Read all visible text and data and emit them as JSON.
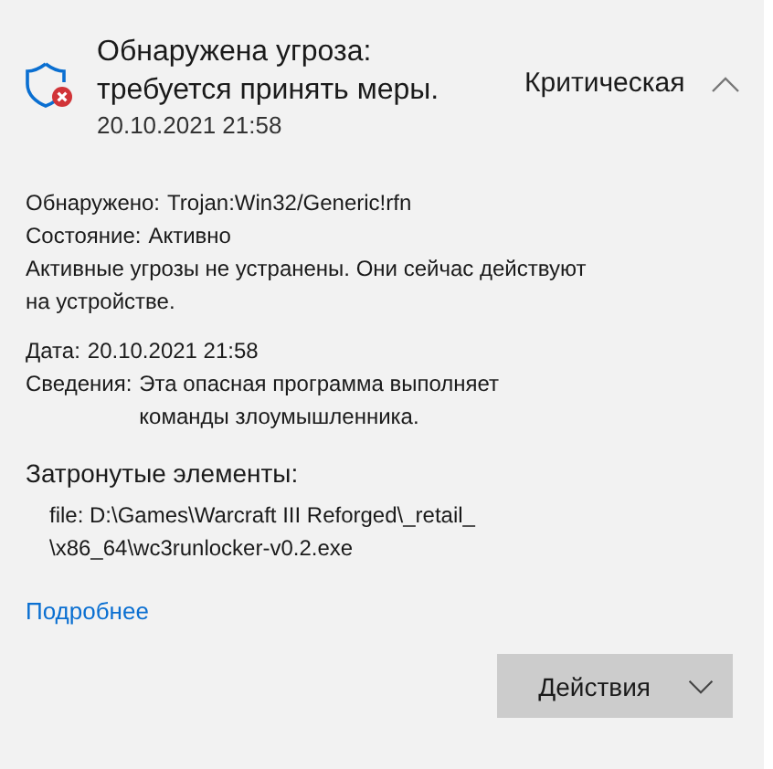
{
  "threat": {
    "title": "Обнаружена угроза: требуется принять меры.",
    "date": "20.10.2021 21:58",
    "severity": "Критическая",
    "expanded": true
  },
  "details": [
    {
      "kind": "field",
      "label": "Обнаружено:",
      "value": "Trojan:Win32/Generic!rfn"
    },
    {
      "kind": "field",
      "label": "Состояние:",
      "value": "Активно"
    },
    {
      "kind": "note",
      "text": "Активные угрозы не устранены. Они сейчас действуют на устройстве."
    }
  ],
  "info": [
    {
      "kind": "field",
      "label": "Дата:",
      "value": "20.10.2021 21:58"
    },
    {
      "kind": "field",
      "label": "Сведения:",
      "value": "Эта опасная программа выполняет команды злоумышленника."
    }
  ],
  "affected": {
    "heading": "Затронутые элементы:",
    "items": [
      "file: D:\\Games\\Warcraft III Reforged\\_retail_\n\\x86_64\\wc3runlocker-v0.2.exe"
    ]
  },
  "link": "Подробнее",
  "action_button": "Действия"
}
